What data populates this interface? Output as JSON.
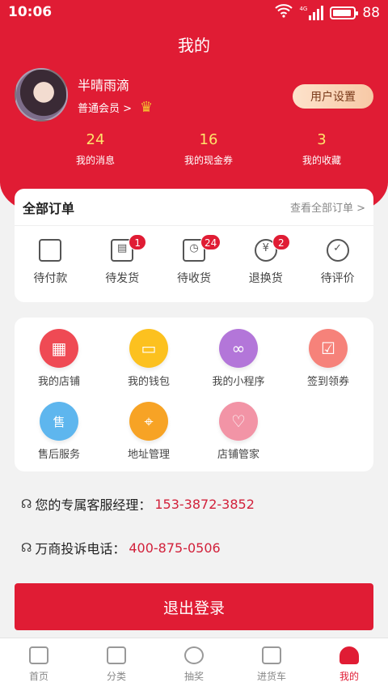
{
  "status": {
    "time": "10:06",
    "network": "4G",
    "battery": "88"
  },
  "header": {
    "title": "我的"
  },
  "profile": {
    "name": "半晴雨滴",
    "level": "普通会员 >",
    "settings_label": "用户设置"
  },
  "stats": [
    {
      "num": "24",
      "label": "我的消息"
    },
    {
      "num": "16",
      "label": "我的现金券"
    },
    {
      "num": "3",
      "label": "我的收藏"
    }
  ],
  "orders": {
    "title": "全部订单",
    "view_all": "查看全部订单 >",
    "items": [
      {
        "label": "待付款",
        "icon": "wallet-icon"
      },
      {
        "label": "待发货",
        "icon": "package-icon",
        "badge": "1"
      },
      {
        "label": "待收货",
        "icon": "delivery-truck-icon",
        "badge": "24"
      },
      {
        "label": "退换货",
        "icon": "refund-icon",
        "badge": "2"
      },
      {
        "label": "待评价",
        "icon": "check-circle-icon"
      }
    ]
  },
  "services": [
    {
      "label": "我的店铺",
      "icon": "shop-icon",
      "color": "#ef4a54"
    },
    {
      "label": "我的钱包",
      "icon": "wallet-icon",
      "color": "#fcc11f"
    },
    {
      "label": "我的小程序",
      "icon": "mini-program-icon",
      "color": "#b376d9"
    },
    {
      "label": "签到领券",
      "icon": "calendar-check-icon",
      "color": "#f6827a"
    },
    {
      "label": "售后服务",
      "icon": "after-sales-icon",
      "glyph": "售",
      "color": "#5eb6ee"
    },
    {
      "label": "地址管理",
      "icon": "location-pin-icon",
      "color": "#f7a325"
    },
    {
      "label": "店铺管家",
      "icon": "heart-icon",
      "color": "#f294a6"
    }
  ],
  "contacts": [
    {
      "label": "您的专属客服经理：",
      "phone": "153-3872-3852"
    },
    {
      "label": "万商投诉电话：",
      "phone": "400-875-0506"
    }
  ],
  "logout_label": "退出登录",
  "tabs": [
    {
      "label": "首页",
      "icon": "home-icon"
    },
    {
      "label": "分类",
      "icon": "category-icon"
    },
    {
      "label": "抽奖",
      "icon": "lottery-icon"
    },
    {
      "label": "进货车",
      "icon": "cart-icon"
    },
    {
      "label": "我的",
      "icon": "user-icon",
      "active": true
    }
  ],
  "colors": {
    "brand_red": "#e01c34",
    "stat_yellow": "#ffe36b"
  }
}
